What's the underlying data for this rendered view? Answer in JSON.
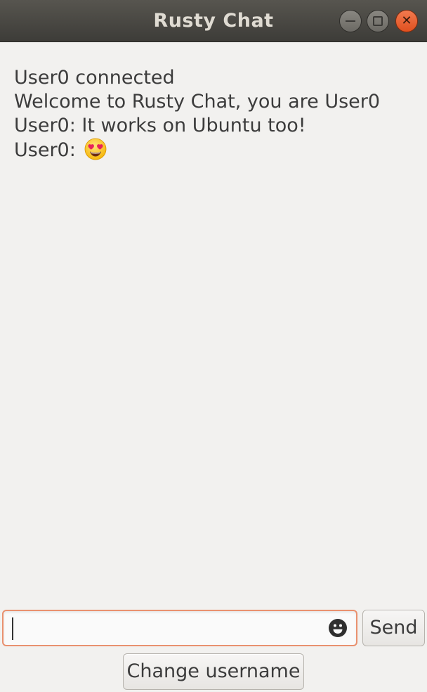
{
  "window": {
    "title": "Rusty Chat",
    "buttons": {
      "minimize_icon": "minimize-icon",
      "maximize_icon": "maximize-icon",
      "close_icon": "close-icon"
    },
    "colors": {
      "titlebar": "#3d3c38",
      "title_text": "#dfdbd2",
      "close_button": "#e0501f",
      "background": "#f2f1ef"
    }
  },
  "messages": [
    {
      "text": "User0 connected",
      "emoji": ""
    },
    {
      "text": "Welcome to Rusty Chat, you are User0",
      "emoji": ""
    },
    {
      "text": "User0: It works on Ubuntu too!",
      "emoji": ""
    },
    {
      "text": "User0:",
      "emoji": "heart-eyes-emoji"
    }
  ],
  "composer": {
    "input_value": "",
    "input_placeholder": "",
    "emoji_icon": "smiley-icon",
    "focus_color": "#e9916f",
    "send_label": "Send"
  },
  "footer": {
    "change_username_label": "Change username"
  }
}
